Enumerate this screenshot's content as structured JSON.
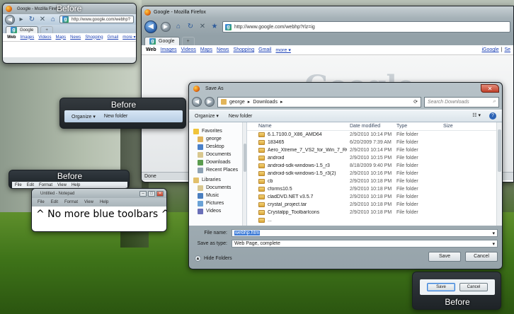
{
  "before_label": "Before",
  "ff_main": {
    "title": "Google - Mozilla Firefox",
    "url": "http://www.google.com/webhp?rlz=ig",
    "tab_label": "Google",
    "newtab": "+",
    "links": [
      "Web",
      "Images",
      "Videos",
      "Maps",
      "News",
      "Shopping",
      "Gmail",
      "more ▾"
    ],
    "right_links": [
      "iGoogle",
      "|",
      "Se"
    ],
    "logo": "Google",
    "status": "Done"
  },
  "ff_before": {
    "title": "Google - Mozilla Firefox",
    "url": "http://www.google.com/webhp?",
    "tab_label": "Google",
    "newtab": "+",
    "links": [
      "Web",
      "Images",
      "Videos",
      "Maps",
      "News",
      "Shopping",
      "Gmail",
      "more ▾"
    ]
  },
  "org_before": {
    "organize": "Organize ▾",
    "new_folder": "New folder"
  },
  "np_before": {
    "menu": [
      "File",
      "Edit",
      "Format",
      "View",
      "Help"
    ]
  },
  "notepad": {
    "title": "Untitled - Notepad",
    "menu": [
      "File",
      "Edit",
      "Format",
      "View",
      "Help"
    ],
    "text": "^ No more blue toolbars ^"
  },
  "save_as": {
    "title": "Save As",
    "path": [
      "george",
      "▸",
      "Downloads",
      "▸"
    ],
    "search_placeholder": "Search Downloads",
    "organize": "Organize ▾",
    "new_folder": "New folder",
    "nav": [
      {
        "label": "Favorites",
        "group": true,
        "color": "#f0c43a"
      },
      {
        "label": "george",
        "group": false,
        "color": "#e2b55a"
      },
      {
        "label": "Desktop",
        "group": false,
        "color": "#4a80c9"
      },
      {
        "label": "Documents",
        "group": false,
        "color": "#d9c88f"
      },
      {
        "label": "Downloads",
        "group": false,
        "color": "#5b9c4f"
      },
      {
        "label": "Recent Places",
        "group": false,
        "color": "#8ea2b4"
      },
      {
        "label": "Libraries",
        "group": true,
        "color": "#e2c06b"
      },
      {
        "label": "Documents",
        "group": false,
        "color": "#d9c88f"
      },
      {
        "label": "Music",
        "group": false,
        "color": "#4a7fc0"
      },
      {
        "label": "Pictures",
        "group": false,
        "color": "#6aa2d6"
      },
      {
        "label": "Videos",
        "group": false,
        "color": "#6a6fb8"
      }
    ],
    "columns": {
      "name": "Name",
      "date": "Date modified",
      "type": "Type",
      "size": "Size"
    },
    "files": [
      {
        "name": "6.1.7100.0_X86_AMD64",
        "date": "2/9/2010 10:14 PM",
        "type": "File folder"
      },
      {
        "name": "183465",
        "date": "6/20/2009 7:39 AM",
        "type": "File folder"
      },
      {
        "name": "Aero_Xtreme_7_VS2_for_Win_7_RC_by_In...",
        "date": "2/9/2010 10:14 PM",
        "type": "File folder"
      },
      {
        "name": "android",
        "date": "2/9/2010 10:15 PM",
        "type": "File folder"
      },
      {
        "name": "android-sdk-windows-1.5_r3",
        "date": "8/18/2009 9:40 PM",
        "type": "File folder"
      },
      {
        "name": "android-sdk-windows-1.5_r3(2)",
        "date": "2/9/2010 10:16 PM",
        "type": "File folder"
      },
      {
        "name": "cb",
        "date": "2/9/2010 10:18 PM",
        "type": "File folder"
      },
      {
        "name": "cforms10.5",
        "date": "2/9/2010 10:18 PM",
        "type": "File folder"
      },
      {
        "name": "cladDVD.NET v3.5.7",
        "date": "2/9/2010 10:18 PM",
        "type": "File folder"
      },
      {
        "name": "crystal_project.tar",
        "date": "2/9/2010 10:18 PM",
        "type": "File folder"
      },
      {
        "name": "Crystalpp_ToolbarIcons",
        "date": "2/9/2010 10:18 PM",
        "type": "File folder"
      },
      {
        "name": "...",
        "date": "",
        "type": ""
      }
    ],
    "file_name_label": "File name:",
    "file_name_value": "webhp.htm",
    "save_type_label": "Save as type:",
    "save_type_value": "Web Page, complete",
    "save": "Save",
    "cancel": "Cancel",
    "hide_folders": "Hide Folders"
  },
  "btn_before": {
    "save": "Save",
    "cancel": "Cancel"
  }
}
